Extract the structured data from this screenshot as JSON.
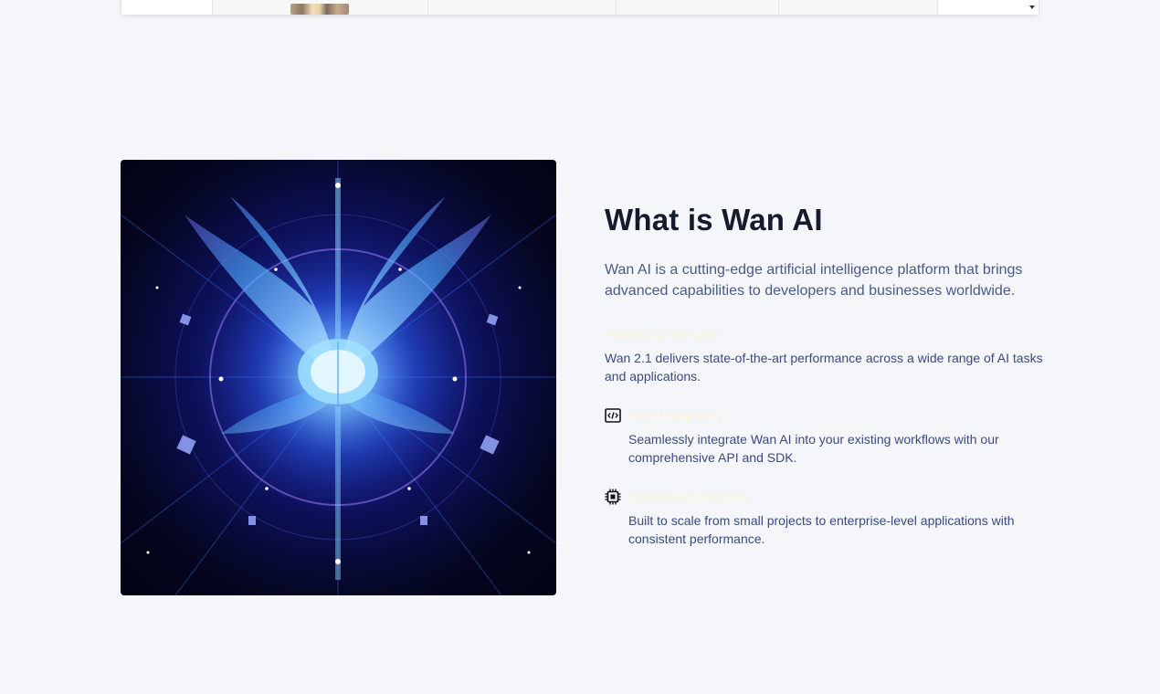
{
  "colors": {
    "page_background": "#f4f6fa",
    "title": "#141b2d",
    "body_text": "#4a5a85",
    "feature_text": "#3a4a80",
    "feature_title": "#fbf4dc"
  },
  "about": {
    "title": "What is Wan AI",
    "description": "Wan AI is a cutting-edge artificial intelligence platform that brings advanced capabilities to developers and businesses worldwide.",
    "features": [
      {
        "title": "Powerful & Versatile",
        "description": "Wan 2.1 delivers state-of-the-art performance across a wide range of AI tasks and applications.",
        "icon": "none"
      },
      {
        "title": "Easy Integration",
        "description": "Seamlessly integrate Wan AI into your existing workflows with our comprehensive API and SDK.",
        "icon": "code-icon"
      },
      {
        "title": "Scalable Architecture",
        "description": "Built to scale from small projects to enterprise-level applications with consistent performance.",
        "icon": "chip-icon"
      }
    ]
  },
  "hero_image": {
    "subject": "glowing blue crystal brain with butterfly wings"
  }
}
